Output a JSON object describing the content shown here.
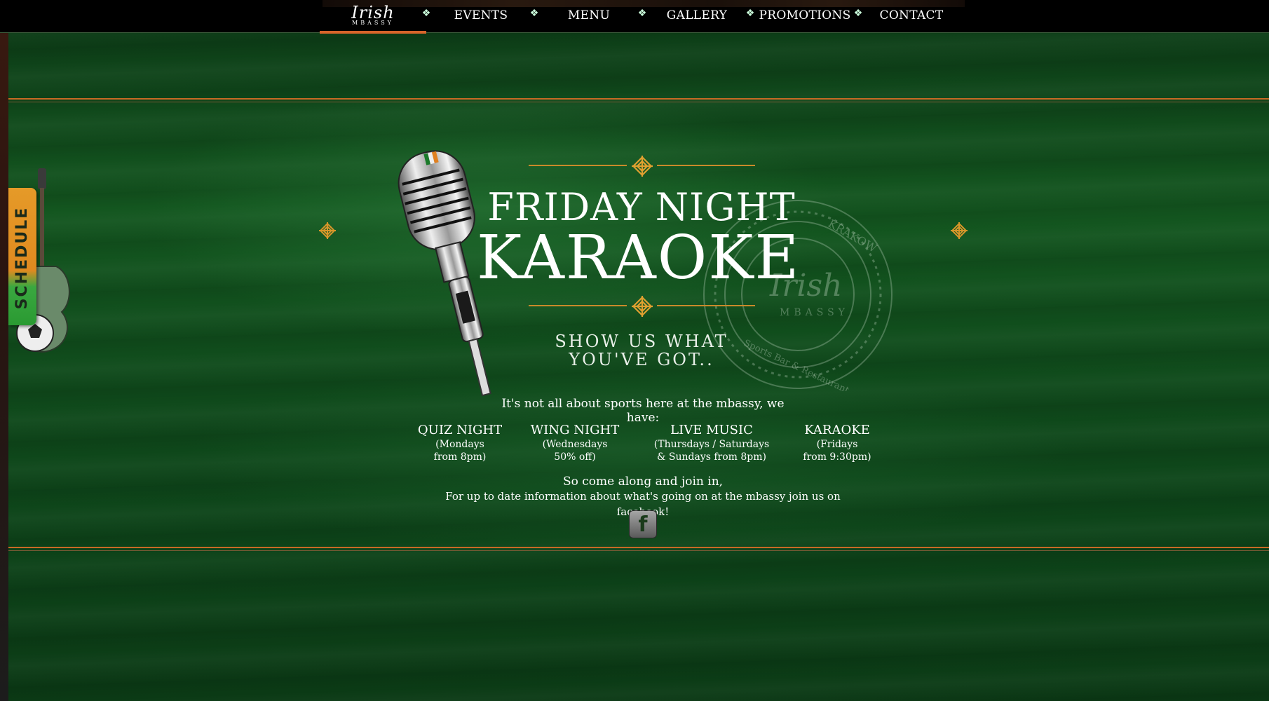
{
  "nav": {
    "logo_main": "Irish",
    "logo_sub": "MBASSY",
    "items": [
      {
        "label": "EVENTS"
      },
      {
        "label": "MENU"
      },
      {
        "label": "GALLERY"
      },
      {
        "label": "PROMOTIONS"
      },
      {
        "label": "CONTACT"
      }
    ]
  },
  "side_tab": {
    "label": "SCHEDULE"
  },
  "hero": {
    "title_line1": "FRIDAY NIGHT",
    "title_line2": "KARAOKE",
    "tagline": "SHOW US WHAT YOU'VE GOT.."
  },
  "seal": {
    "top_text": "KRAKOW",
    "center_text": "Irish",
    "center_sub": "MBASSY",
    "bottom_text": "Sports Bar & Restaurant"
  },
  "content": {
    "intro": "It's  not all about sports here at the mbassy, we have:",
    "events": [
      {
        "name": "QUIZ NIGHT",
        "details": "(Mondays\nfrom 8pm)"
      },
      {
        "name": "WING NIGHT",
        "details": "(Wednesdays\n50% off)"
      },
      {
        "name": "LIVE MUSIC",
        "details": "(Thursdays / Saturdays\n& Sundays from 8pm)"
      },
      {
        "name": "KARAOKE",
        "details": "(Fridays\nfrom 9:30pm)"
      }
    ],
    "outro_line1": "So come along and join in,",
    "outro_line2": "For up to date information about what's going on at the mbassy join us on facebook!",
    "facebook_icon": "facebook-icon"
  },
  "colors": {
    "accent_orange": "#c86a25",
    "ornament_gold": "#d9962a",
    "background_green": "#13561f"
  }
}
